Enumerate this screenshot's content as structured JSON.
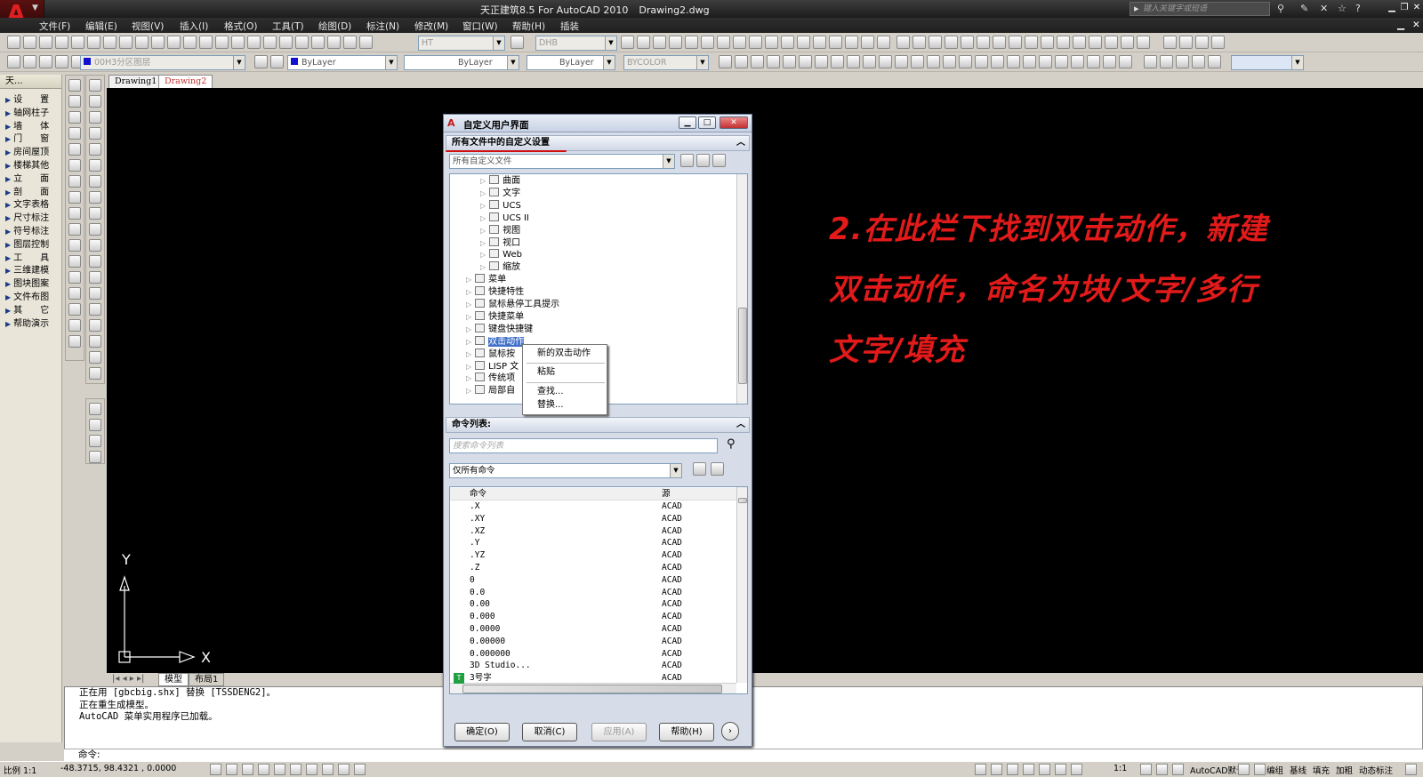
{
  "title_bar": {
    "app_title": "天正建筑8.5 For AutoCAD 2010",
    "document_name": "Drawing2.dwg",
    "search_placeholder": "键入关键字或短语"
  },
  "menu": [
    "文件(F)",
    "编辑(E)",
    "视图(V)",
    "插入(I)",
    "格式(O)",
    "工具(T)",
    "绘图(D)",
    "标注(N)",
    "修改(M)",
    "窗口(W)",
    "帮助(H)",
    "插装"
  ],
  "toolbars": {
    "text_style": "HT",
    "dim_style": "DHB",
    "layer": "00H3分区图层",
    "color": "ByLayer",
    "linetype": "ByLayer",
    "lineweight": "ByLayer",
    "plotstyle": "BYCOLOR"
  },
  "left_menu": {
    "header": "天...",
    "items": [
      "设　　置",
      "轴网柱子",
      "墙　　体",
      "门　　窗",
      "房间屋顶",
      "楼梯其他",
      "立　　面",
      "剖　　面",
      "文字表格",
      "尺寸标注",
      "符号标注",
      "图层控制",
      "工　　具",
      "三维建模",
      "图块图案",
      "文件布图",
      "其　　它",
      "帮助演示"
    ]
  },
  "doc_tabs": [
    "Drawing1",
    "Drawing2"
  ],
  "annotation_lines": [
    "2.在此栏下找到双击动作，新建",
    "双击动作，命名为块/文字/多行",
    "文字/填充"
  ],
  "ucs": {
    "x": "X",
    "y": "Y"
  },
  "layout_tabs": [
    "模型",
    "布局1"
  ],
  "command_history": [
    "正在用 [gbcbig.shx] 替换 [TSSDENG2]。",
    "正在重生成模型。",
    "AutoCAD 菜单实用程序已加载。"
  ],
  "command_prompt": "命令:",
  "status": {
    "scale": "比例 1:1",
    "coords": "-48.3715, 98.4321 , 0.0000",
    "anno_scale": "1:1",
    "workspace": "AutoCAD默认",
    "toggles": [
      "编组",
      "基线",
      "填充",
      "加粗",
      "动态标注"
    ]
  },
  "dialog": {
    "title": "自定义用户界面",
    "section_all": "所有文件中的自定义设置",
    "files_combo": "所有自定义文件",
    "tree": [
      {
        "label": "曲面",
        "level": 3
      },
      {
        "label": "文字",
        "level": 3
      },
      {
        "label": "UCS",
        "level": 3
      },
      {
        "label": "UCS II",
        "level": 3
      },
      {
        "label": "视图",
        "level": 3
      },
      {
        "label": "视口",
        "level": 3
      },
      {
        "label": "Web",
        "level": 3
      },
      {
        "label": "缩放",
        "level": 3
      },
      {
        "label": "菜单",
        "level": 2
      },
      {
        "label": "快捷特性",
        "level": 2
      },
      {
        "label": "鼠标悬停工具提示",
        "level": 2
      },
      {
        "label": "快捷菜单",
        "level": 2
      },
      {
        "label": "键盘快捷键",
        "level": 2
      },
      {
        "label": "双击动作",
        "level": 2,
        "selected": true
      },
      {
        "label": "鼠标按",
        "level": 2
      },
      {
        "label": "LISP 文",
        "level": 2
      },
      {
        "label": "传统项",
        "level": 2
      },
      {
        "label": "局部自",
        "level": 2
      }
    ],
    "context_menu": [
      "新的双击动作",
      "粘贴",
      "查找...",
      "替换..."
    ],
    "section_cmd": "命令列表:",
    "cmd_search_placeholder": "搜索命令列表",
    "cmd_filter": "仅所有命令",
    "cmd_header": {
      "command": "命令",
      "source": "源"
    },
    "commands": [
      {
        "c": ".X",
        "s": "ACAD"
      },
      {
        "c": ".XY",
        "s": "ACAD"
      },
      {
        "c": ".XZ",
        "s": "ACAD"
      },
      {
        "c": ".Y",
        "s": "ACAD"
      },
      {
        "c": ".YZ",
        "s": "ACAD"
      },
      {
        "c": ".Z",
        "s": "ACAD"
      },
      {
        "c": "0",
        "s": "ACAD"
      },
      {
        "c": "0.0",
        "s": "ACAD"
      },
      {
        "c": "0.00",
        "s": "ACAD"
      },
      {
        "c": "0.000",
        "s": "ACAD"
      },
      {
        "c": "0.0000",
        "s": "ACAD"
      },
      {
        "c": "0.00000",
        "s": "ACAD"
      },
      {
        "c": "0.000000",
        "s": "ACAD"
      },
      {
        "c": "3D Studio...",
        "s": "ACAD"
      },
      {
        "c": "3号字",
        "s": "ACAD"
      }
    ],
    "buttons": {
      "ok": "确定(O)",
      "cancel": "取消(C)",
      "apply": "应用(A)",
      "help": "帮助(H)"
    }
  },
  "colors": {
    "annotation": "#e21a1a",
    "canvas": "#000000",
    "underline": "#d01010"
  }
}
